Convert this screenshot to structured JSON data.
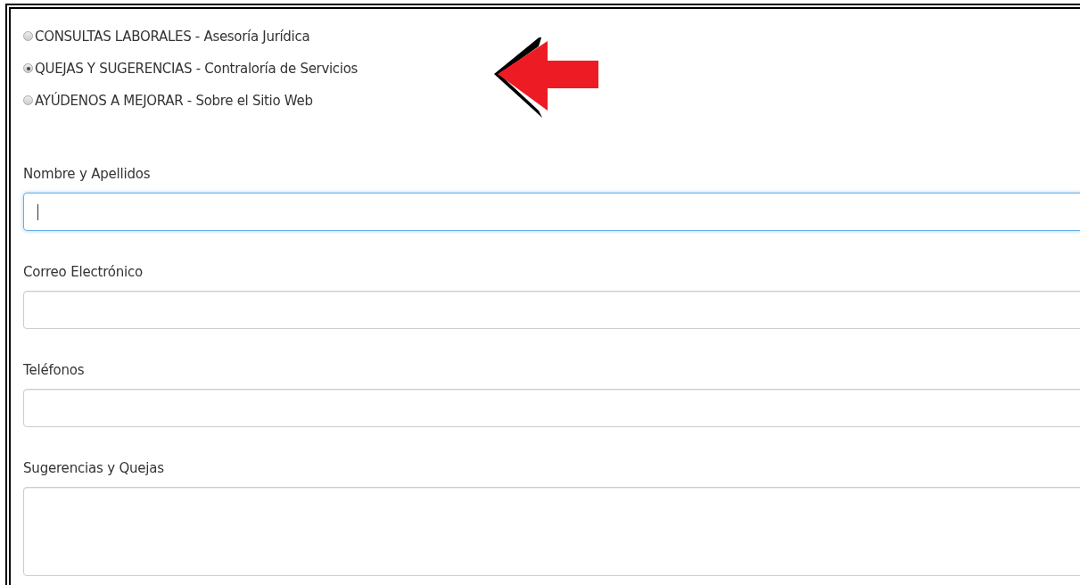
{
  "options": [
    {
      "label": "CONSULTAS LABORALES - Asesoría Jurídica",
      "selected": false
    },
    {
      "label": "QUEJAS Y SUGERENCIAS - Contraloría de Servicios",
      "selected": true
    },
    {
      "label": "AYÚDENOS A MEJORAR - Sobre el Sitio Web",
      "selected": false
    }
  ],
  "fields": [
    {
      "label": "Nombre y Apellidos",
      "kind": "input",
      "focused": true
    },
    {
      "label": "Correo Electrónico",
      "kind": "input",
      "focused": false
    },
    {
      "label": "Teléfonos",
      "kind": "input",
      "focused": false
    },
    {
      "label": "Sugerencias y Quejas",
      "kind": "textarea",
      "focused": false
    }
  ]
}
